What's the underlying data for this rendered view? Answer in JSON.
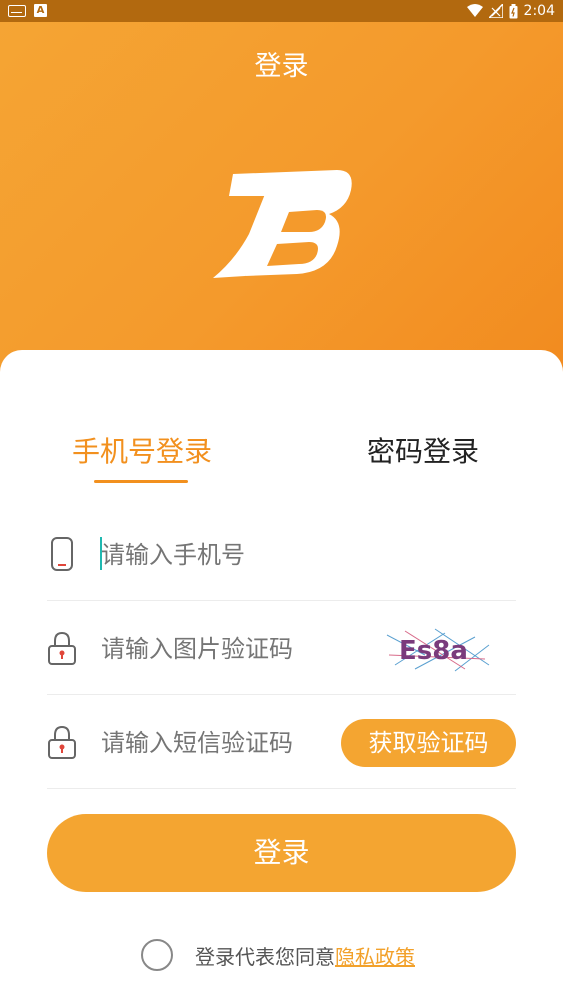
{
  "statusbar": {
    "time": "2:04",
    "left_icons": [
      "keyboard-icon",
      "a-icon"
    ],
    "right_icons": [
      "wifi-icon",
      "signal-icon",
      "battery-icon"
    ]
  },
  "header": {
    "title": "登录",
    "logo_icon": "b-logo-icon"
  },
  "tabs": [
    {
      "label": "手机号登录",
      "active": true
    },
    {
      "label": "密码登录",
      "active": false
    }
  ],
  "fields": {
    "phone": {
      "placeholder": "请输入手机号",
      "icon": "phone-icon"
    },
    "image_code": {
      "placeholder": "请输入图片验证码",
      "icon": "lock-icon",
      "captcha_text": "Es8a"
    },
    "sms_code": {
      "placeholder": "请输入短信验证码",
      "icon": "lock-icon",
      "button_label": "获取验证码"
    }
  },
  "login_button": "登录",
  "agreement": {
    "text": "登录代表您同意",
    "link": "隐私政策",
    "checked": false
  },
  "colors": {
    "accent": "#f4a531",
    "tab_active": "#f2901e",
    "header_start": "#f5a534",
    "header_end": "#f28b1f"
  }
}
